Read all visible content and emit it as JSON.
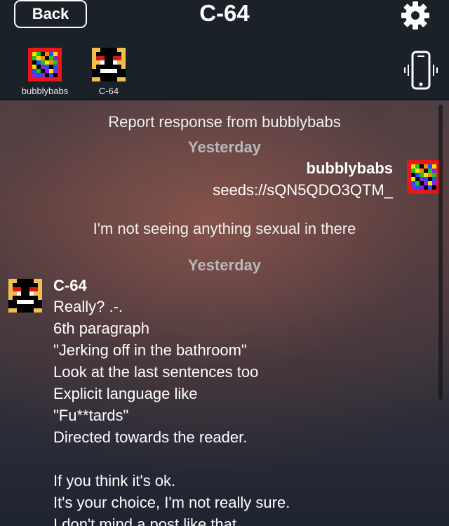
{
  "header": {
    "back_label": "Back",
    "title": "C-64"
  },
  "participants": [
    {
      "name": "bubblybabs",
      "avatar": "rainbow-pixel-avatar"
    },
    {
      "name": "C-64",
      "avatar": "pixel-face-avatar"
    }
  ],
  "messages": {
    "system_notice": "Report response from bubblybabs",
    "date_1": "Yesterday",
    "outgoing": {
      "sender": "bubblybabs",
      "text": "seeds://sQN5QDO3QTM_"
    },
    "centered_note": "I'm not seeing anything sexual in there",
    "date_2": "Yesterday",
    "incoming": {
      "sender": "C-64",
      "lines": [
        "Really? .-.",
        "6th paragraph",
        "\"Jerking off in the bathroom\"",
        "Look at the last sentences too",
        "Explicit language like",
        "\"Fu**tards\"",
        "Directed towards the reader.",
        "",
        "If you think it's ok.",
        "It's your choice, I'm not really sure.",
        "I don't mind a post like that."
      ]
    }
  },
  "colors": {
    "topbar": "#1b2129",
    "text": "#ffffff",
    "date_separator": "#b8b8b8"
  }
}
